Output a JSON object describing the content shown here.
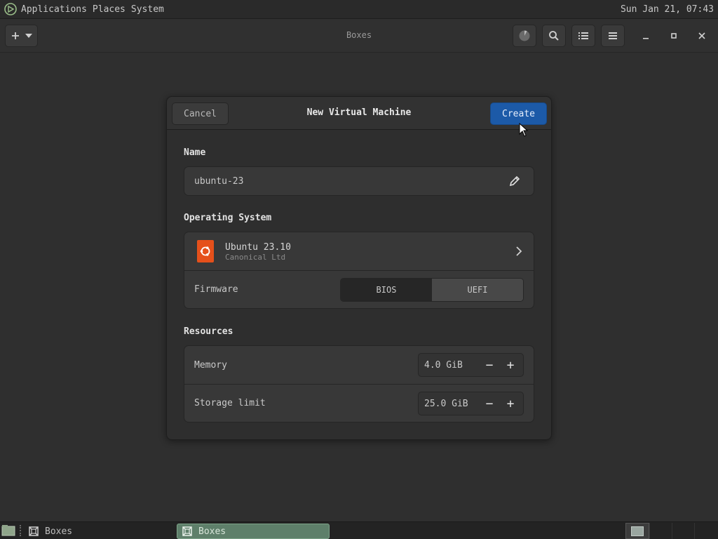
{
  "top_panel": {
    "menus": [
      "Applications",
      "Places",
      "System"
    ],
    "clock": "Sun Jan 21, 07:43"
  },
  "headerbar": {
    "title": "Boxes",
    "add_icon": "plus-icon",
    "add_dropdown_icon": "chevron-down-icon"
  },
  "dialog": {
    "title": "New Virtual Machine",
    "cancel_label": "Cancel",
    "create_label": "Create",
    "name_section": "Name",
    "name_value": "ubuntu-23",
    "os_section": "Operating System",
    "os_name": "Ubuntu 23.10",
    "os_vendor": "Canonical Ltd",
    "firmware_label": "Firmware",
    "firmware_options": [
      "BIOS",
      "UEFI"
    ],
    "firmware_selected": "BIOS",
    "resources_section": "Resources",
    "memory_label": "Memory",
    "memory_value": "4.0 GiB",
    "storage_label": "Storage limit",
    "storage_value": "25.0 GiB",
    "minus": "−",
    "plus": "+"
  },
  "taskbar": {
    "items": [
      "Boxes",
      "Boxes"
    ]
  },
  "colors": {
    "accent": "#1c5aa8",
    "os_icon": "#e5501b",
    "taskbar_active": "#5e7f6a"
  }
}
